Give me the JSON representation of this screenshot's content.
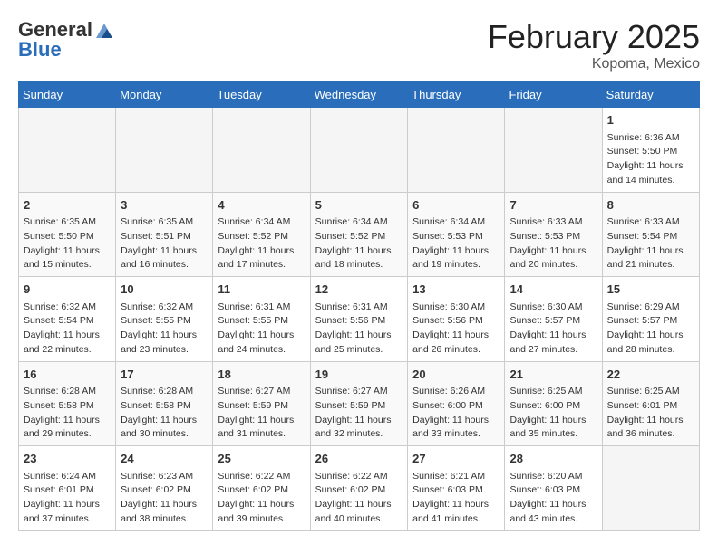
{
  "header": {
    "logo_general": "General",
    "logo_blue": "Blue",
    "title": "February 2025",
    "location": "Kopoma, Mexico"
  },
  "days_of_week": [
    "Sunday",
    "Monday",
    "Tuesday",
    "Wednesday",
    "Thursday",
    "Friday",
    "Saturday"
  ],
  "weeks": [
    [
      {
        "day": "",
        "info": ""
      },
      {
        "day": "",
        "info": ""
      },
      {
        "day": "",
        "info": ""
      },
      {
        "day": "",
        "info": ""
      },
      {
        "day": "",
        "info": ""
      },
      {
        "day": "",
        "info": ""
      },
      {
        "day": "1",
        "info": "Sunrise: 6:36 AM\nSunset: 5:50 PM\nDaylight: 11 hours and 14 minutes."
      }
    ],
    [
      {
        "day": "2",
        "info": "Sunrise: 6:35 AM\nSunset: 5:50 PM\nDaylight: 11 hours and 15 minutes."
      },
      {
        "day": "3",
        "info": "Sunrise: 6:35 AM\nSunset: 5:51 PM\nDaylight: 11 hours and 16 minutes."
      },
      {
        "day": "4",
        "info": "Sunrise: 6:34 AM\nSunset: 5:52 PM\nDaylight: 11 hours and 17 minutes."
      },
      {
        "day": "5",
        "info": "Sunrise: 6:34 AM\nSunset: 5:52 PM\nDaylight: 11 hours and 18 minutes."
      },
      {
        "day": "6",
        "info": "Sunrise: 6:34 AM\nSunset: 5:53 PM\nDaylight: 11 hours and 19 minutes."
      },
      {
        "day": "7",
        "info": "Sunrise: 6:33 AM\nSunset: 5:53 PM\nDaylight: 11 hours and 20 minutes."
      },
      {
        "day": "8",
        "info": "Sunrise: 6:33 AM\nSunset: 5:54 PM\nDaylight: 11 hours and 21 minutes."
      }
    ],
    [
      {
        "day": "9",
        "info": "Sunrise: 6:32 AM\nSunset: 5:54 PM\nDaylight: 11 hours and 22 minutes."
      },
      {
        "day": "10",
        "info": "Sunrise: 6:32 AM\nSunset: 5:55 PM\nDaylight: 11 hours and 23 minutes."
      },
      {
        "day": "11",
        "info": "Sunrise: 6:31 AM\nSunset: 5:55 PM\nDaylight: 11 hours and 24 minutes."
      },
      {
        "day": "12",
        "info": "Sunrise: 6:31 AM\nSunset: 5:56 PM\nDaylight: 11 hours and 25 minutes."
      },
      {
        "day": "13",
        "info": "Sunrise: 6:30 AM\nSunset: 5:56 PM\nDaylight: 11 hours and 26 minutes."
      },
      {
        "day": "14",
        "info": "Sunrise: 6:30 AM\nSunset: 5:57 PM\nDaylight: 11 hours and 27 minutes."
      },
      {
        "day": "15",
        "info": "Sunrise: 6:29 AM\nSunset: 5:57 PM\nDaylight: 11 hours and 28 minutes."
      }
    ],
    [
      {
        "day": "16",
        "info": "Sunrise: 6:28 AM\nSunset: 5:58 PM\nDaylight: 11 hours and 29 minutes."
      },
      {
        "day": "17",
        "info": "Sunrise: 6:28 AM\nSunset: 5:58 PM\nDaylight: 11 hours and 30 minutes."
      },
      {
        "day": "18",
        "info": "Sunrise: 6:27 AM\nSunset: 5:59 PM\nDaylight: 11 hours and 31 minutes."
      },
      {
        "day": "19",
        "info": "Sunrise: 6:27 AM\nSunset: 5:59 PM\nDaylight: 11 hours and 32 minutes."
      },
      {
        "day": "20",
        "info": "Sunrise: 6:26 AM\nSunset: 6:00 PM\nDaylight: 11 hours and 33 minutes."
      },
      {
        "day": "21",
        "info": "Sunrise: 6:25 AM\nSunset: 6:00 PM\nDaylight: 11 hours and 35 minutes."
      },
      {
        "day": "22",
        "info": "Sunrise: 6:25 AM\nSunset: 6:01 PM\nDaylight: 11 hours and 36 minutes."
      }
    ],
    [
      {
        "day": "23",
        "info": "Sunrise: 6:24 AM\nSunset: 6:01 PM\nDaylight: 11 hours and 37 minutes."
      },
      {
        "day": "24",
        "info": "Sunrise: 6:23 AM\nSunset: 6:02 PM\nDaylight: 11 hours and 38 minutes."
      },
      {
        "day": "25",
        "info": "Sunrise: 6:22 AM\nSunset: 6:02 PM\nDaylight: 11 hours and 39 minutes."
      },
      {
        "day": "26",
        "info": "Sunrise: 6:22 AM\nSunset: 6:02 PM\nDaylight: 11 hours and 40 minutes."
      },
      {
        "day": "27",
        "info": "Sunrise: 6:21 AM\nSunset: 6:03 PM\nDaylight: 11 hours and 41 minutes."
      },
      {
        "day": "28",
        "info": "Sunrise: 6:20 AM\nSunset: 6:03 PM\nDaylight: 11 hours and 43 minutes."
      },
      {
        "day": "",
        "info": ""
      }
    ]
  ]
}
